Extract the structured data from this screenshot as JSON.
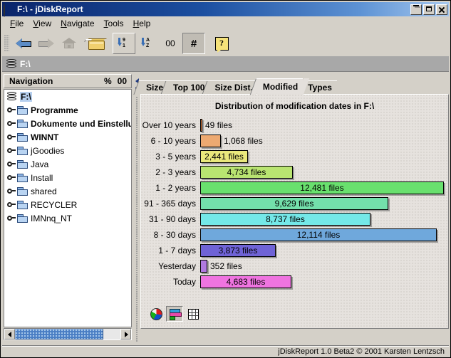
{
  "window": {
    "title": "F:\\ - jDiskReport",
    "icon": "pie-chart-icon",
    "controls": {
      "minimize": "_",
      "maximize": "□",
      "close": "×"
    }
  },
  "menubar": {
    "items": [
      {
        "mnemonic": "F",
        "rest": "ile"
      },
      {
        "mnemonic": "V",
        "rest": "iew"
      },
      {
        "mnemonic": "N",
        "rest": "avigate"
      },
      {
        "mnemonic": "T",
        "rest": "ools"
      },
      {
        "mnemonic": "H",
        "rest": "elp"
      }
    ]
  },
  "toolbar": {
    "back": "back-arrow",
    "forward": "forward-arrow",
    "home": "home-house",
    "open": "open-folder",
    "sort_numeric": {
      "top": "9",
      "bottom": "1"
    },
    "sort_alpha": {
      "top": "A",
      "bottom": "Z"
    },
    "count_label": "00",
    "hash_label": "#",
    "help": "?"
  },
  "pathbar": {
    "icon": "disk-icon",
    "path": "F:\\"
  },
  "sidebar": {
    "header": {
      "title": "Navigation",
      "percent_symbol": "%",
      "value": "00"
    },
    "items": [
      {
        "label": "F:\\",
        "type": "drive",
        "bold": true,
        "selected": true
      },
      {
        "label": "Programme",
        "type": "folder",
        "bold": true,
        "selected": false
      },
      {
        "label": "Dokumente und Einstellungen",
        "type": "folder",
        "bold": true,
        "selected": false
      },
      {
        "label": "WINNT",
        "type": "folder",
        "bold": true,
        "selected": false
      },
      {
        "label": "jGoodies",
        "type": "folder",
        "bold": false,
        "selected": false
      },
      {
        "label": "Java",
        "type": "folder",
        "bold": false,
        "selected": false
      },
      {
        "label": "Install",
        "type": "folder",
        "bold": false,
        "selected": false
      },
      {
        "label": "shared",
        "type": "folder",
        "bold": false,
        "selected": false
      },
      {
        "label": "RECYCLER",
        "type": "folder",
        "bold": false,
        "selected": false
      },
      {
        "label": "IMNnq_NT",
        "type": "folder",
        "bold": false,
        "selected": false
      }
    ]
  },
  "tabs": [
    {
      "label": "Size",
      "active": false
    },
    {
      "label": "Top 100",
      "active": false
    },
    {
      "label": "Size Dist.",
      "active": false
    },
    {
      "label": "Modified",
      "active": true
    },
    {
      "label": "Types",
      "active": false
    }
  ],
  "chart_data": {
    "type": "bar",
    "orientation": "horizontal",
    "title": "Distribution of modification dates in F:\\",
    "xlabel": "",
    "ylabel": "",
    "grid": false,
    "legend": "none",
    "xlim": [
      0,
      12481
    ],
    "categories": [
      "Over 10 years",
      "6 - 10 years",
      "3 - 5 years",
      "2 - 3 years",
      "1 - 2 years",
      "91 - 365 days",
      "31 - 90 days",
      "8 - 30 days",
      "1 - 7 days",
      "Yesterday",
      "Today"
    ],
    "values": [
      49,
      1068,
      2441,
      4734,
      12481,
      9629,
      8737,
      12114,
      3873,
      352,
      4683
    ],
    "data_labels": [
      "49 files",
      "1,068 files",
      "2,441 files",
      "4,734 files",
      "12,481 files",
      "9,629 files",
      "8,737 files",
      "12,114 files",
      "3,873 files",
      "352 files",
      "4,683 files"
    ],
    "label_inside": [
      false,
      false,
      true,
      true,
      true,
      true,
      true,
      true,
      true,
      false,
      true
    ],
    "colors": [
      "#e07b3c",
      "#eda971",
      "#e9e87c",
      "#b9e471",
      "#69e06e",
      "#73e0ab",
      "#74e8e8",
      "#6fa8dc",
      "#6f63d6",
      "#b07ae0",
      "#ef74e0"
    ]
  },
  "chart_toolbar": {
    "buttons": [
      {
        "name": "pie-view",
        "selected": false
      },
      {
        "name": "bar-view",
        "selected": true
      },
      {
        "name": "table-view",
        "selected": false
      }
    ]
  },
  "statusbar": {
    "text": "jDiskReport 1.0 Beta2  © 2001 Karsten Lentzsch"
  }
}
